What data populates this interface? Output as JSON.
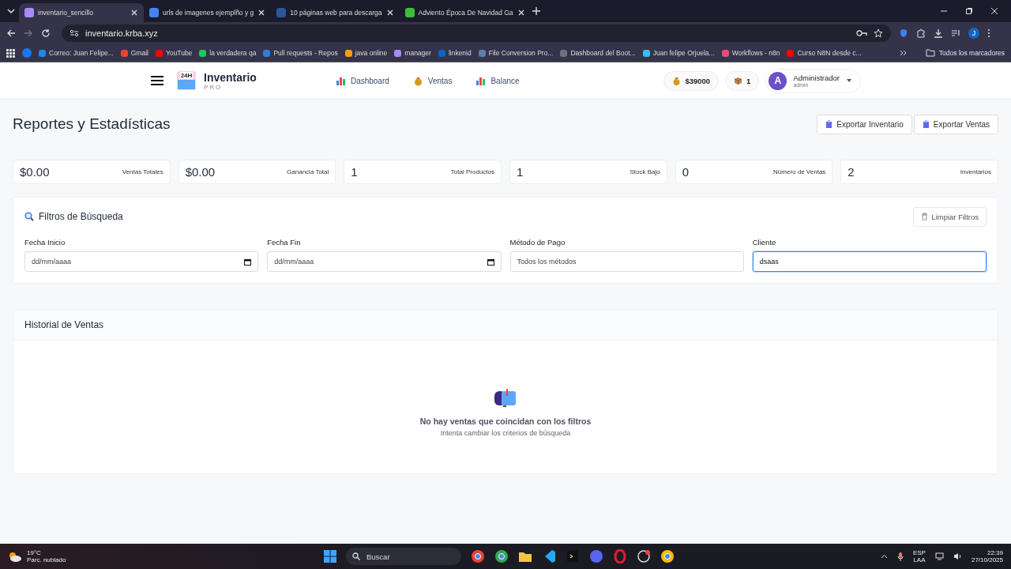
{
  "browser": {
    "tabs": [
      {
        "title": "inventario_sencillo",
        "selected": true
      },
      {
        "title": "urls de imagenes ejemplño y g",
        "selected": false
      },
      {
        "title": "10 páginas web para descarga",
        "selected": false
      },
      {
        "title": "Adviento Época De Navidad Ga",
        "selected": false
      }
    ],
    "url": "inventario.krba.xyz",
    "profile_initial": "J",
    "bookmarks": [
      {
        "label": "Correo: Juan Felipe...",
        "color": "#1e88e5"
      },
      {
        "label": "Gmail",
        "color": "#ea4335"
      },
      {
        "label": "YouTube",
        "color": "#ff0000"
      },
      {
        "label": "la verdadera qa",
        "color": "#22c55e"
      },
      {
        "label": "Pull requests - Repos",
        "color": "#2f7fd8"
      },
      {
        "label": "java online",
        "color": "#f59e0b"
      },
      {
        "label": "manager",
        "color": "#a78bfa"
      },
      {
        "label": "linkenid",
        "color": "#0a66c2"
      },
      {
        "label": "File Conversion Pro...",
        "color": "#5b7fa8"
      },
      {
        "label": "Dashboard del Boot...",
        "color": "#6b7280"
      },
      {
        "label": "Juan felipe Orjuela...",
        "color": "#38bdf8"
      },
      {
        "label": "Workflows - n8n",
        "color": "#ea4b71"
      },
      {
        "label": "Curso N8N desde c...",
        "color": "#ff0000"
      }
    ],
    "all_bookmarks": "Todos los marcadores"
  },
  "app": {
    "brand": {
      "title": "Inventario",
      "subtitle": "PRO",
      "badge": "24H"
    },
    "nav": [
      {
        "label": "Dashboard"
      },
      {
        "label": "Ventas"
      },
      {
        "label": "Balance"
      }
    ],
    "balance": "$39000",
    "cart_count": "1",
    "user": {
      "initial": "A",
      "name": "Administrador",
      "role": "admin"
    }
  },
  "page_title": "Reportes y Estadísticas",
  "export_buttons": [
    "Exportar Inventario",
    "Exportar Ventas"
  ],
  "stats": [
    {
      "amount": "$0.00",
      "caption": "Ventas Totales"
    },
    {
      "amount": "$0.00",
      "caption": "Ganancia Total"
    },
    {
      "amount": "1",
      "caption": "Total Productos"
    },
    {
      "amount": "1",
      "caption": "Stock Bajo"
    },
    {
      "amount": "0",
      "caption": "Número de Ventas"
    },
    {
      "amount": "2",
      "caption": "Inventarios"
    }
  ],
  "filters": {
    "title": "Filtros de Búsqueda",
    "clear_button": "Limpiar Filtros",
    "fields": [
      {
        "label": "Fecha Inicio",
        "kind": "date",
        "placeholder": "dd/mm/aaaa",
        "focused": false
      },
      {
        "label": "Fecha Fin",
        "kind": "date",
        "placeholder": "dd/mm/aaaa",
        "focused": false
      },
      {
        "label": "Método de Pago",
        "kind": "select",
        "value": "Todos los métodos",
        "focused": false
      },
      {
        "label": "Cliente",
        "kind": "text",
        "value": "dsaas",
        "focused": true
      }
    ]
  },
  "history": {
    "title": "Historial de Ventas",
    "empty_title": "No hay ventas que coincidan con los filtros",
    "empty_hint": "Intenta cambiar los criterios de búsqueda"
  },
  "taskbar": {
    "weather": {
      "temp": "19°C",
      "desc": "Parc. nublado"
    },
    "search": "Buscar",
    "lang": "ESP",
    "region": "LAA",
    "time": "22:39",
    "date": "27/10/2025"
  }
}
